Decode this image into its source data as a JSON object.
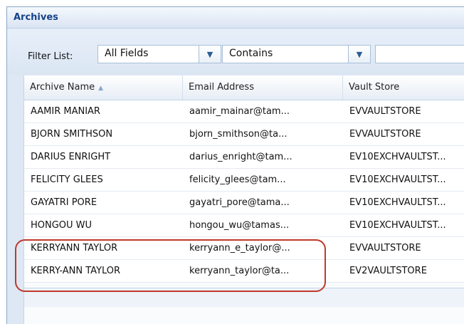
{
  "panel": {
    "title": "Archives"
  },
  "filter": {
    "label": "Filter List:",
    "field_value": "All Fields",
    "operator_value": "Contains",
    "search_value": ""
  },
  "icons": {
    "dropdown": "chevron-down-icon",
    "sort": "sort-ascending-icon"
  },
  "colors": {
    "title_text": "#15428b",
    "highlight": "#c0392b",
    "panel_bg": "#dde8f4"
  },
  "grid": {
    "columns": [
      "Archive Name",
      "Email Address",
      "Vault Store"
    ],
    "sort_glyph": "▲",
    "rows": [
      [
        "AAMIR MANIAR",
        "aamir_mainar@tam...",
        "EVVAULTSTORE"
      ],
      [
        "BJORN SMITHSON",
        "bjorn_smithson@ta...",
        "EVVAULTSTORE"
      ],
      [
        "DARIUS ENRIGHT",
        "darius_enright@tam...",
        "EV10EXCHVAULTST..."
      ],
      [
        "FELICITY GLEES",
        "felicity_glees@tam...",
        "EV10EXCHVAULTST..."
      ],
      [
        "GAYATRI PORE",
        "gayatri_pore@tama...",
        "EV10EXCHVAULTST..."
      ],
      [
        "HONGOU WU",
        "hongou_wu@tamas...",
        "EV10EXCHVAULTST..."
      ],
      [
        "KERRYANN TAYLOR",
        "kerryann_e_taylor@...",
        "EVVAULTSTORE"
      ],
      [
        "KERRY-ANN TAYLOR",
        "kerryann_taylor@ta...",
        "EV2VAULTSTORE"
      ]
    ]
  }
}
